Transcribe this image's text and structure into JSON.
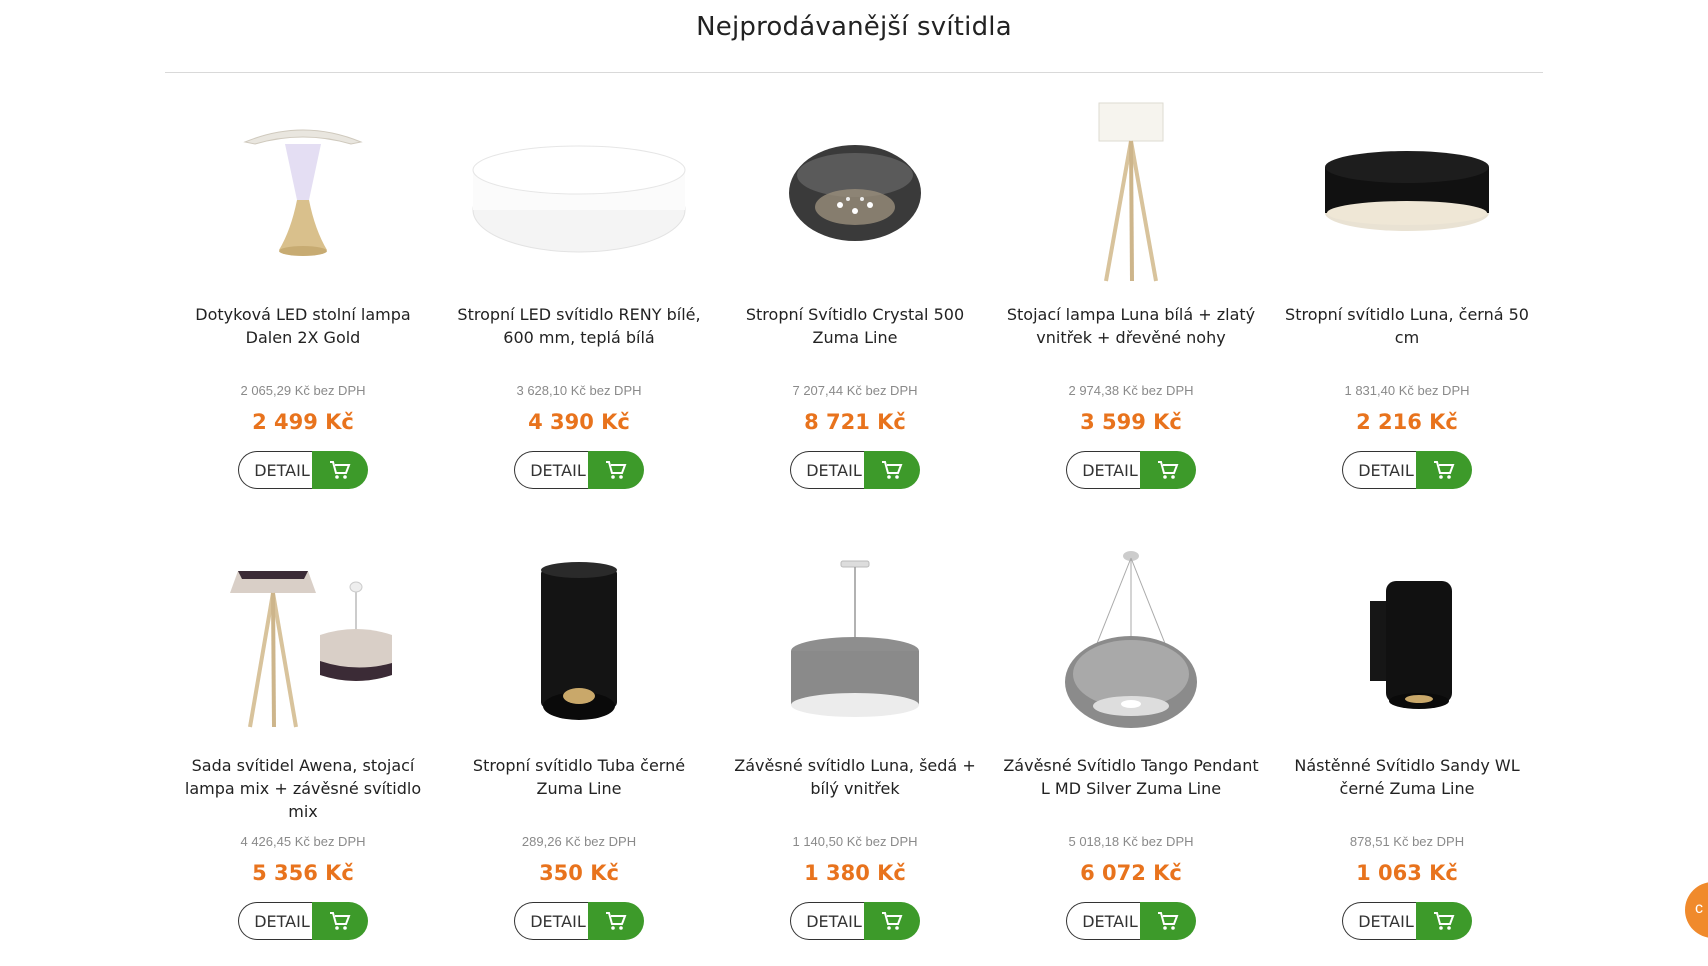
{
  "section": {
    "title": "Nejprodávanější svítidla"
  },
  "detail_label": "DETAIL",
  "products": [
    {
      "name": "Dotyková LED stolní lampa Dalen 2X Gold",
      "net": "2 065,29 Kč bez DPH",
      "price": "2 499 Kč",
      "icon": "table-lamp-gold"
    },
    {
      "name": "Stropní LED svítidlo RENY bílé, 600 mm, teplá bílá",
      "net": "3 628,10 Kč bez DPH",
      "price": "4 390 Kč",
      "icon": "ceiling-light-white"
    },
    {
      "name": "Stropní Svítidlo Crystal 500 Zuma Line",
      "net": "7 207,44 Kč bez DPH",
      "price": "8 721 Kč",
      "icon": "ceiling-crystal"
    },
    {
      "name": "Stojací lampa Luna bílá + zlatý vnitřek + dřevěné nohy",
      "net": "2 974,38 Kč bez DPH",
      "price": "3 599 Kč",
      "icon": "floor-lamp-tripod"
    },
    {
      "name": "Stropní svítidlo Luna, černá 50 cm",
      "net": "1 831,40 Kč bez DPH",
      "price": "2 216 Kč",
      "icon": "ceiling-light-black"
    },
    {
      "name": "Sada svítidel Awena, stojací lampa mix + závěsné svítidlo mix",
      "net": "4 426,45 Kč bez DPH",
      "price": "5 356 Kč",
      "icon": "lamp-set"
    },
    {
      "name": "Stropní svítidlo Tuba černé Zuma Line",
      "net": "289,26 Kč bez DPH",
      "price": "350 Kč",
      "icon": "spot-tube-black"
    },
    {
      "name": "Závěsné svítidlo Luna, šedá + bílý vnitřek",
      "net": "1 140,50 Kč bez DPH",
      "price": "1 380 Kč",
      "icon": "pendant-grey"
    },
    {
      "name": "Závěsné Svítidlo Tango Pendant L MD Silver Zuma Line",
      "net": "5 018,18 Kč bez DPH",
      "price": "6 072 Kč",
      "icon": "pendant-silver"
    },
    {
      "name": "Nástěnné Svítidlo Sandy WL černé Zuma Line",
      "net": "878,51 Kč bez DPH",
      "price": "1 063 Kč",
      "icon": "wall-light-black"
    }
  ],
  "colors": {
    "price": "#e8731d",
    "cart_button": "#3d9a2a",
    "chat_button": "#f08a2c"
  },
  "chat": {
    "label": "c"
  }
}
